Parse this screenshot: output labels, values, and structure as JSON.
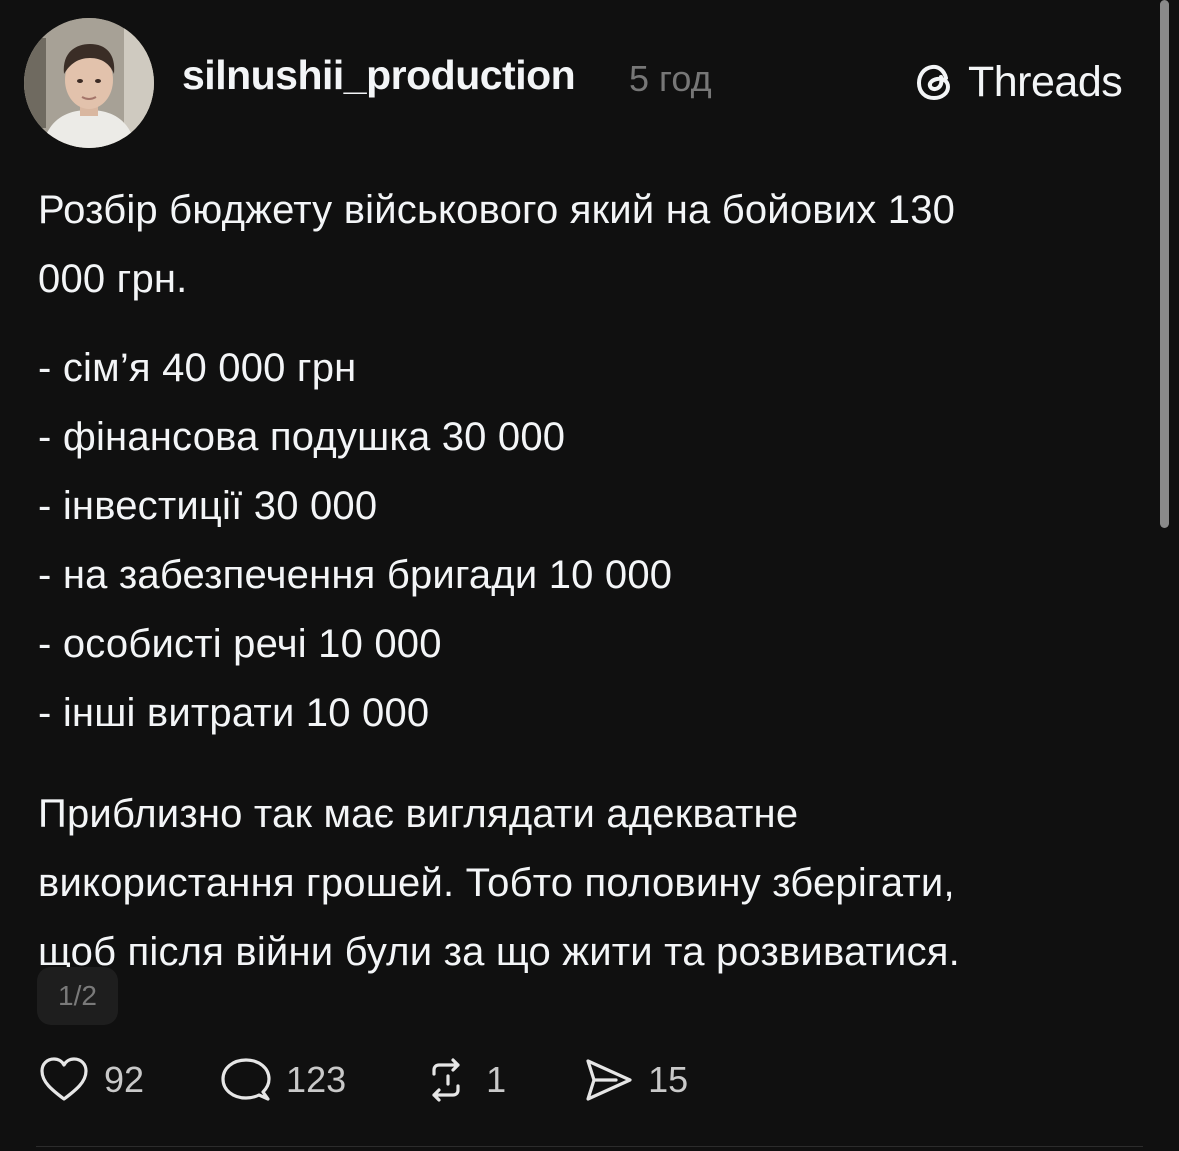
{
  "post": {
    "username": "silnushii_production",
    "time_ago": "5 год",
    "brand_label": "Threads",
    "intro": "Розбір бюджету військового який на бойових 130\n000 грн.",
    "budget_items": [
      "- сім’я 40 000 грн",
      "- фінансова подушка 30 000",
      "- інвестиції 30 000",
      "- на забезпечення бригади 10 000",
      "- особисті речі 10 000",
      "- інші витрати 10 000"
    ],
    "closing": "Приблизно так має виглядати адекватне\nвикористання грошей. Тобто половину зберігати,\nщоб після війни були за що жити та розвиватися.",
    "page_indicator": "1/2"
  },
  "actions": {
    "likes": "92",
    "comments": "123",
    "reposts": "1",
    "shares": "15"
  },
  "icons": {
    "avatar": "profile-photo",
    "brand": "threads-logo-icon",
    "like": "heart-icon",
    "comment": "comment-bubble-icon",
    "repost": "repost-icon",
    "share": "send-icon"
  },
  "colors": {
    "background": "#101010",
    "text": "#f3f5f7",
    "muted": "#777777",
    "badge_bg": "#1e1e1e"
  }
}
